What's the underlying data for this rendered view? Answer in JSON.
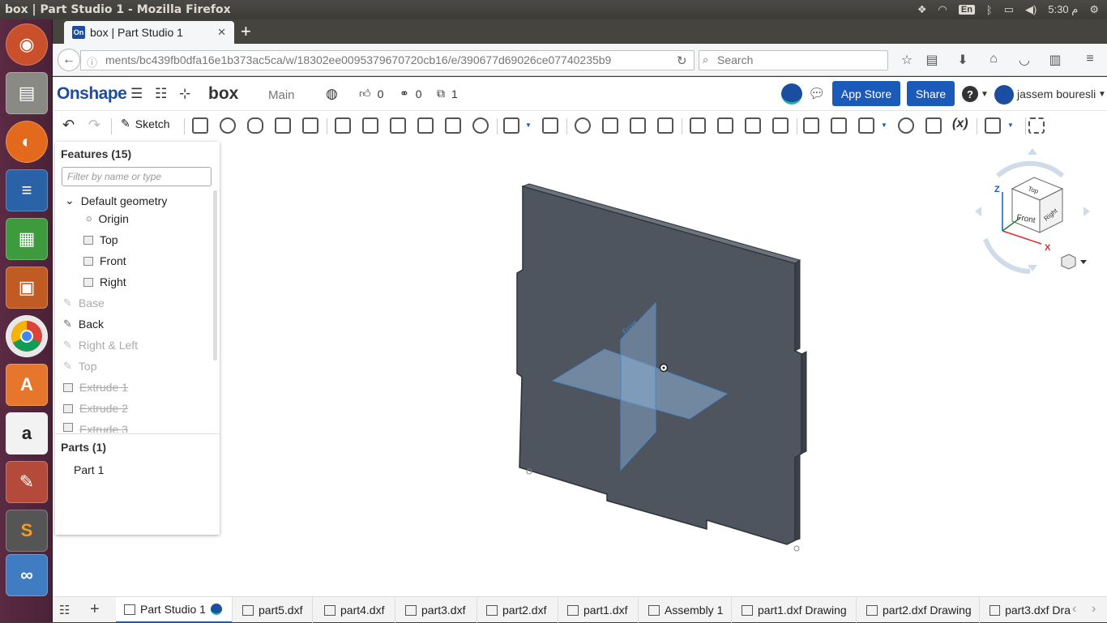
{
  "system": {
    "window_title": "box | Part Studio 1 - Mozilla Firefox",
    "keyboard_layout": "En",
    "clock": "5:30 م"
  },
  "browser": {
    "tab_title": "box | Part Studio 1",
    "favicon_text": "On",
    "url": "ments/bc439fb0dfa16e1b373ac5ca/w/18302ee0095379670720cb16/e/390677d69026ce07740235b9",
    "search_placeholder": "Search"
  },
  "onshape": {
    "logo": "Onshape",
    "document_name": "box",
    "workspace": "Main",
    "likes": "0",
    "links": "0",
    "copies": "1",
    "app_store_label": "App Store",
    "share_label": "Share",
    "help_label": "?",
    "user_name": "jassem bouresli",
    "sketch_label": "Sketch"
  },
  "feature_panel": {
    "title": "Features (15)",
    "filter_placeholder": "Filter by name or type",
    "default_geometry": "Default geometry",
    "items": [
      {
        "label": "Origin",
        "kind": "origin"
      },
      {
        "label": "Top",
        "kind": "plane"
      },
      {
        "label": "Front",
        "kind": "plane"
      },
      {
        "label": "Right",
        "kind": "plane"
      },
      {
        "label": "Base",
        "kind": "sketch-dim"
      },
      {
        "label": "Back",
        "kind": "sketch"
      },
      {
        "label": "Right & Left",
        "kind": "sketch-dim"
      },
      {
        "label": "Top",
        "kind": "sketch-dim"
      },
      {
        "label": "Extrude 1",
        "kind": "extrude-suppressed"
      },
      {
        "label": "Extrude 2",
        "kind": "extrude-suppressed"
      },
      {
        "label": "Extrude 3",
        "kind": "extrude-suppressed"
      }
    ],
    "parts_title": "Parts (1)",
    "parts": [
      "Part 1"
    ]
  },
  "view_cube": {
    "top": "Top",
    "front": "Front",
    "right": "Right",
    "axis_z": "Z",
    "axis_x": "X"
  },
  "bottom_tabs": [
    {
      "label": "Part Studio 1",
      "active": true
    },
    {
      "label": "part5.dxf"
    },
    {
      "label": "part4.dxf"
    },
    {
      "label": "part3.dxf"
    },
    {
      "label": "part2.dxf"
    },
    {
      "label": "part1.dxf"
    },
    {
      "label": "Assembly 1"
    },
    {
      "label": "part1.dxf Drawing"
    },
    {
      "label": "part2.dxf Drawing"
    },
    {
      "label": "part3.dxf Dra"
    }
  ],
  "colors": {
    "brand_blue": "#1b4ea0",
    "button_blue": "#1b5ab8",
    "part_gray": "#4e555e",
    "plane_blue": "#8fb3d9"
  }
}
